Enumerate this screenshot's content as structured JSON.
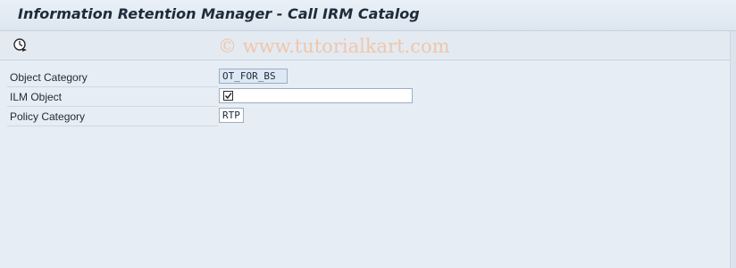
{
  "header": {
    "title": "Information Retention Manager - Call IRM Catalog"
  },
  "toolbar": {
    "execute_icon": "clock-execute-icon"
  },
  "watermark": {
    "text": "© www.tutorialkart.com"
  },
  "form": {
    "object_category": {
      "label": "Object Category",
      "value": "OT_FOR_BS"
    },
    "ilm_object": {
      "label": "ILM Object",
      "checked": true
    },
    "policy_category": {
      "label": "Policy Category",
      "value": "RTP"
    }
  },
  "colors": {
    "background": "#e7edf4",
    "watermark": "#f1c6a8",
    "title_text": "#1f2b3a"
  }
}
